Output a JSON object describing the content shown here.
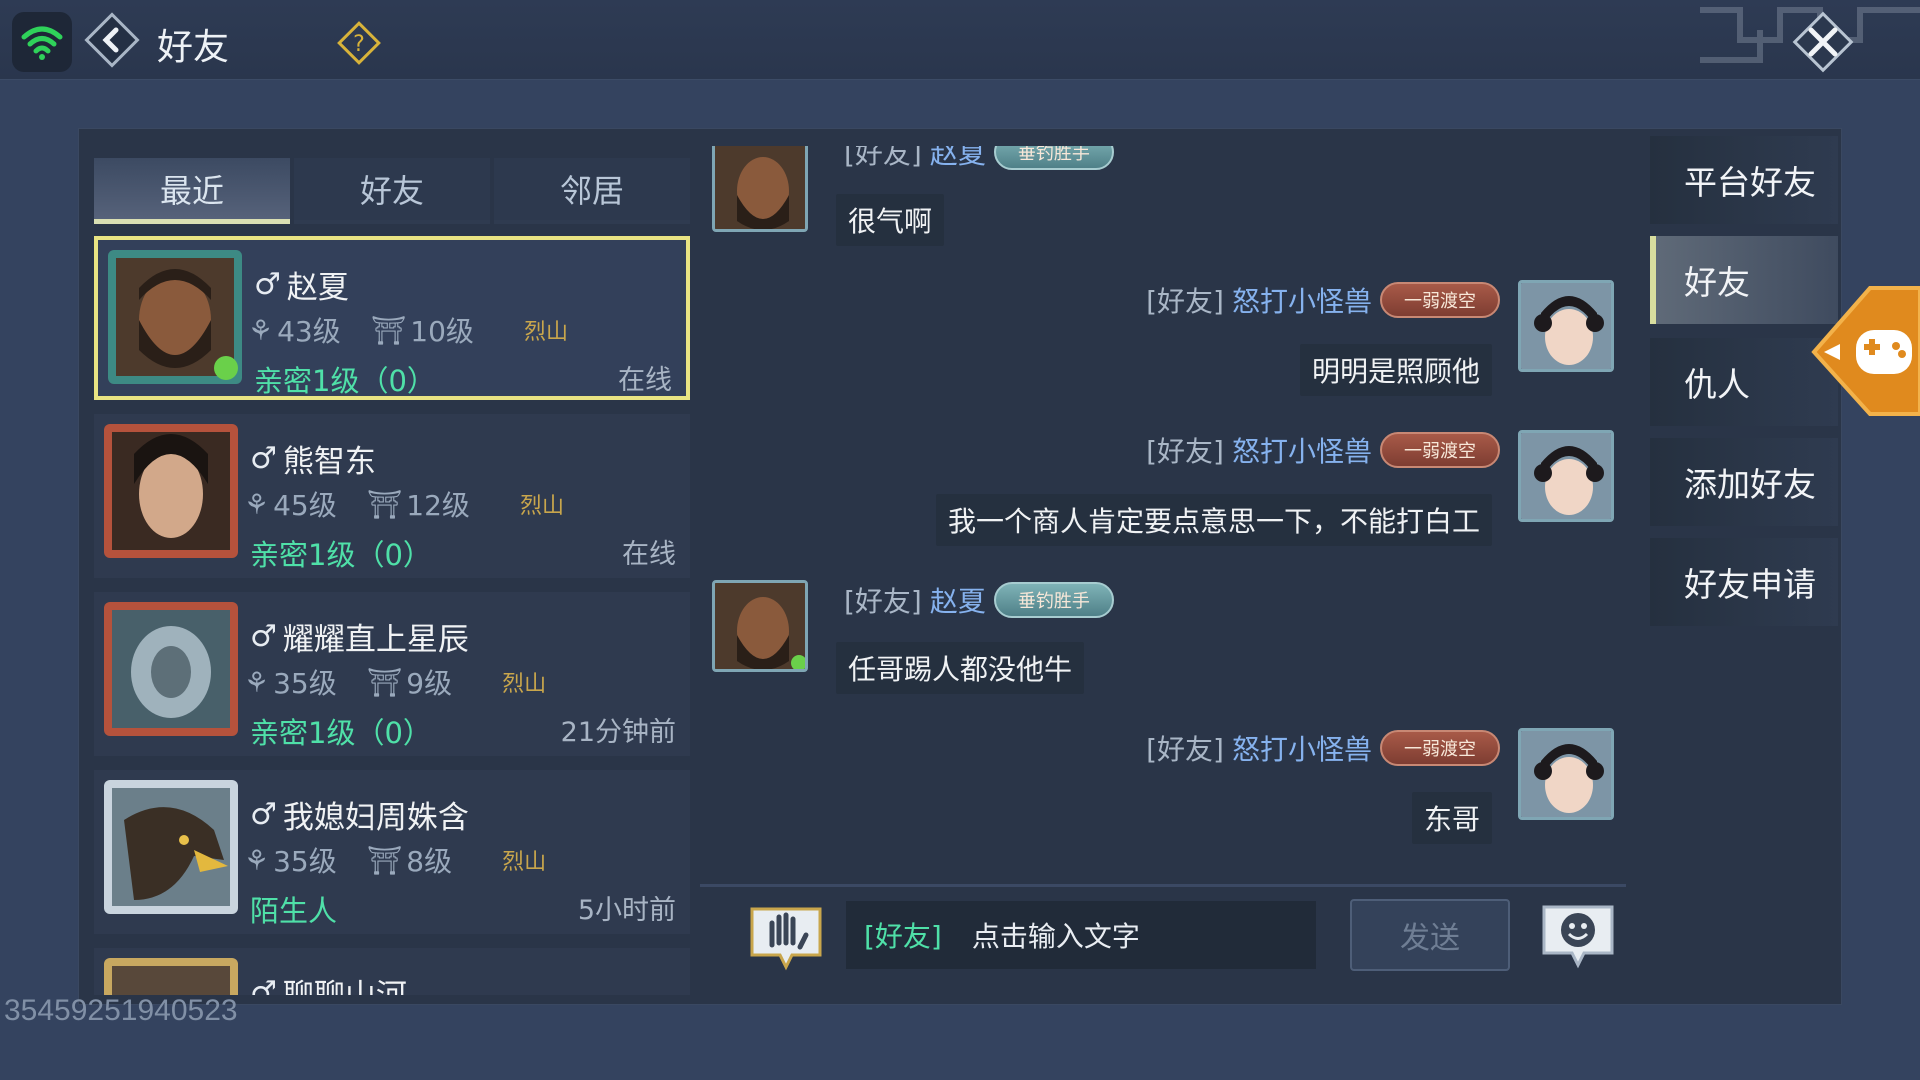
{
  "header": {
    "title": "好友",
    "icons": {
      "wifi": "wifi-icon",
      "back": "back-arrow-icon",
      "help": "question-diamond-icon",
      "close": "close-x-icon"
    }
  },
  "tabs": [
    {
      "label": "最近",
      "active": true
    },
    {
      "label": "好友",
      "active": false
    },
    {
      "label": "邻居",
      "active": false
    }
  ],
  "friends": [
    {
      "name": "赵夏",
      "gender": "♂",
      "power": "43级",
      "level": "10级",
      "sect": "烈山",
      "intimacy": "亲密1级（0）",
      "status": "在线",
      "selected": true
    },
    {
      "name": "熊智东",
      "gender": "♂",
      "power": "45级",
      "level": "12级",
      "sect": "烈山",
      "intimacy": "亲密1级（0）",
      "status": "在线",
      "selected": false
    },
    {
      "name": "耀耀直上星辰",
      "gender": "♂",
      "power": "35级",
      "level": "9级",
      "sect": "烈山",
      "intimacy": "亲密1级（0）",
      "status": "21分钟前",
      "selected": false
    },
    {
      "name": "我媳妇周姝含",
      "gender": "♂",
      "power": "35级",
      "level": "8级",
      "sect": "烈山",
      "intimacy": "陌生人",
      "status": "5小时前",
      "selected": false
    },
    {
      "name": "聊聊山河",
      "gender": "♂",
      "power": "",
      "level": "",
      "sect": "",
      "intimacy": "",
      "status": "",
      "selected": false
    }
  ],
  "chat": {
    "messages": [
      {
        "channel": "[好友]",
        "sender": "赵夏",
        "badge": "垂钓胜手",
        "text": "很气啊",
        "side": "left"
      },
      {
        "channel": "[好友]",
        "sender": "怒打小怪兽",
        "badge": "一弱渡空",
        "text": "明明是照顾他",
        "side": "right"
      },
      {
        "channel": "[好友]",
        "sender": "怒打小怪兽",
        "badge": "一弱渡空",
        "text": "我一个商人肯定要点意思一下，不能打白工",
        "side": "right"
      },
      {
        "channel": "[好友]",
        "sender": "赵夏",
        "badge": "垂钓胜手",
        "text": "任哥踢人都没他牛",
        "side": "left"
      },
      {
        "channel": "[好友]",
        "sender": "怒打小怪兽",
        "badge": "一弱渡空",
        "text": "东哥",
        "side": "right"
      }
    ]
  },
  "input": {
    "channel": "[好友]",
    "placeholder": "点击输入文字",
    "send_label": "发送"
  },
  "side_menu": [
    {
      "label": "平台好友",
      "active": false
    },
    {
      "label": "好友",
      "active": true
    },
    {
      "label": "仇人",
      "active": false
    },
    {
      "label": "添加好友",
      "active": false
    },
    {
      "label": "好友申请",
      "active": false
    }
  ],
  "watermark": "35459251940523",
  "colors": {
    "background": "#34435f",
    "selected_border": "#e9e483",
    "intimacy_green": "#4fe0a8",
    "sender_blue": "#86b2ee",
    "sect_gold": "#c9a64c"
  }
}
